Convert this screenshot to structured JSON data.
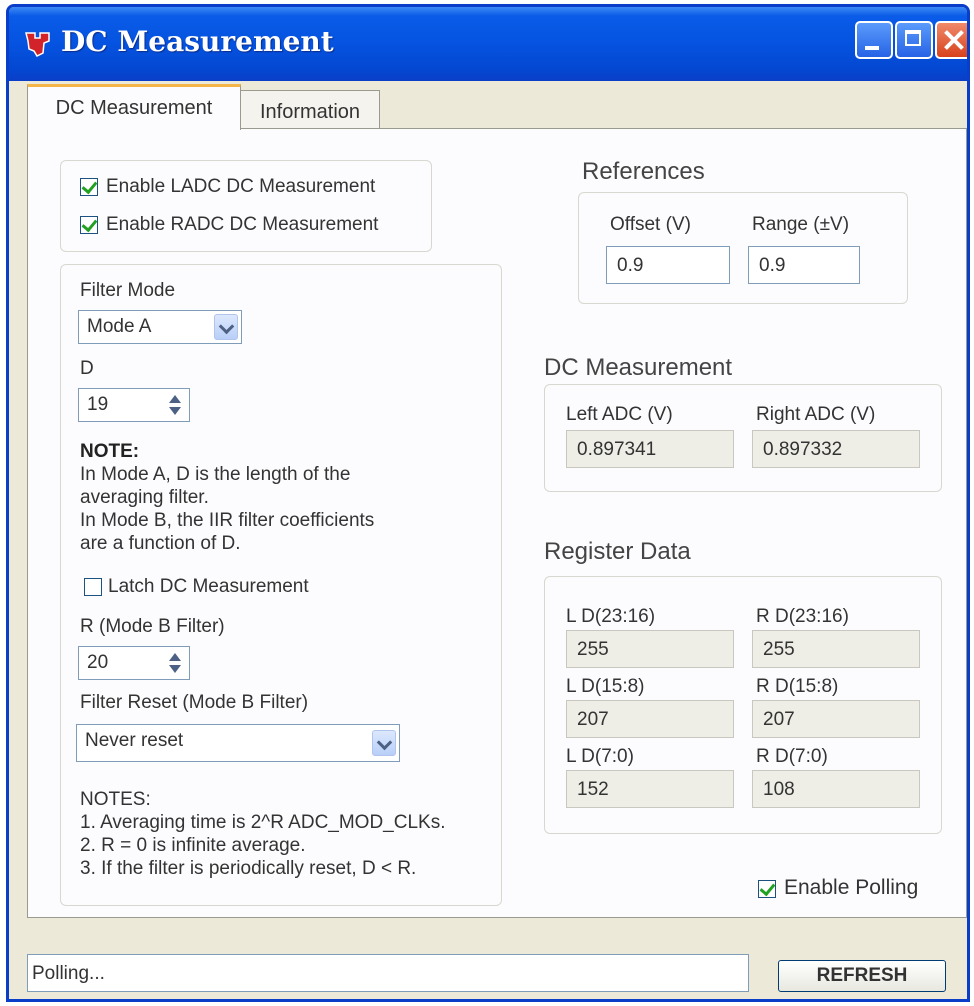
{
  "window": {
    "title": "DC Measurement",
    "minimize_icon": "minimize-icon",
    "maximize_icon": "maximize-icon",
    "close_icon": "close-icon"
  },
  "tabs": [
    {
      "label": "DC Measurement",
      "active": true
    },
    {
      "label": "Information",
      "active": false
    }
  ],
  "enable": {
    "ladc_label": "Enable LADC DC Measurement",
    "ladc_checked": true,
    "radc_label": "Enable RADC DC Measurement",
    "radc_checked": true
  },
  "filter": {
    "mode_label": "Filter Mode",
    "mode_value": "Mode A",
    "d_label": "D",
    "d_value": "19",
    "note_title": "NOTE:",
    "note_lines": [
      "In Mode A, D is the length of the",
      "averaging filter.",
      "In Mode B, the IIR filter coefficients",
      "are a function of D."
    ],
    "latch_label": "Latch DC Measurement",
    "latch_checked": false,
    "r_label": "R (Mode B Filter)",
    "r_value": "20",
    "reset_label": "Filter Reset (Mode B Filter)",
    "reset_value": "Never reset",
    "notes_title": "NOTES:",
    "notes_lines": [
      "1. Averaging time is 2^R ADC_MOD_CLKs.",
      "2. R = 0 is infinite average.",
      "3. If the filter is periodically reset, D < R."
    ]
  },
  "references": {
    "heading": "References",
    "offset_label": "Offset (V)",
    "offset_value": "0.9",
    "range_label": "Range (±V)",
    "range_value": "0.9"
  },
  "dc_measurement": {
    "heading": "DC Measurement",
    "left_label": "Left ADC (V)",
    "left_value": "0.897341",
    "right_label": "Right ADC (V)",
    "right_value": "0.897332"
  },
  "register": {
    "heading": "Register Data",
    "rows": [
      {
        "l_label": "L D(23:16)",
        "l_value": "255",
        "r_label": "R D(23:16)",
        "r_value": "255"
      },
      {
        "l_label": "L D(15:8)",
        "l_value": "207",
        "r_label": "R D(15:8)",
        "r_value": "207"
      },
      {
        "l_label": "L D(7:0)",
        "l_value": "152",
        "r_label": "R D(7:0)",
        "r_value": "108"
      }
    ]
  },
  "polling": {
    "label": "Enable Polling",
    "checked": true
  },
  "status": {
    "text": "Polling...",
    "refresh_label": "REFRESH"
  },
  "colors": {
    "titlebar": "#0553e0",
    "window_bg": "#ece9d8",
    "tab_accent": "#f4b54a",
    "check": "#21a121"
  }
}
